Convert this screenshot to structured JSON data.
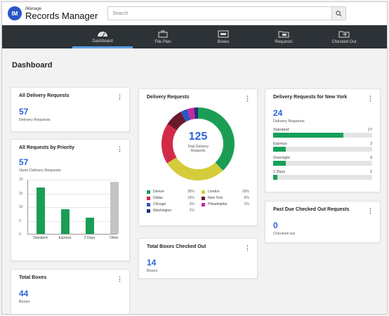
{
  "app": {
    "logo_text": "IM",
    "brand_small": "iManage",
    "brand_big": "Records Manager",
    "search_placeholder": "Search"
  },
  "nav": {
    "items": [
      {
        "label": "Dashboard",
        "icon": "gauge-icon",
        "active": true
      },
      {
        "label": "File Plan",
        "icon": "briefcase-icon",
        "active": false
      },
      {
        "label": "Boxes",
        "icon": "box-icon",
        "active": false
      },
      {
        "label": "Requests",
        "icon": "folder-request-icon",
        "active": false
      },
      {
        "label": "Checked Out",
        "icon": "folder-checkout-icon",
        "active": false
      }
    ]
  },
  "page": {
    "title": "Dashboard"
  },
  "cards": {
    "all_delivery": {
      "title": "All Delivery Requests",
      "value": "57",
      "sub": "Delivery Requests"
    },
    "by_priority": {
      "title": "All Requests by Priority",
      "value": "57",
      "sub": "Open Delivery Requests",
      "chart_data": {
        "type": "bar",
        "categories": [
          "Standard",
          "Express",
          "2 Days",
          "Other"
        ],
        "values": [
          17,
          9,
          6,
          19
        ],
        "colors": [
          "#1a9e55",
          "#1a9e55",
          "#1a9e55",
          "#c4c4c4"
        ],
        "yticks": [
          "20",
          "15",
          "10",
          "5",
          "0"
        ],
        "ylim": [
          0,
          20
        ]
      }
    },
    "total_boxes": {
      "title": "Total Boxes",
      "value": "44",
      "sub": "Boxes"
    },
    "delivery_requests": {
      "title": "Delivery Requests",
      "center_value": "125",
      "center_sub": "Total Delivery Requests",
      "chart_data": {
        "type": "pie",
        "series": [
          {
            "name": "Denver",
            "value": 38,
            "color": "#1a9e55",
            "pct": "38%"
          },
          {
            "name": "London",
            "value": 28,
            "color": "#d4cc3a",
            "pct": "28%"
          },
          {
            "name": "Dallas",
            "value": 18,
            "color": "#d42a4a",
            "pct": "18%"
          },
          {
            "name": "New York",
            "value": 8,
            "color": "#6b1a2a",
            "pct": "8%"
          },
          {
            "name": "Chicago",
            "value": 3,
            "color": "#2a56c6",
            "pct": "3%"
          },
          {
            "name": "Philadelphia",
            "value": 3,
            "color": "#c42a9e",
            "pct": "3%"
          },
          {
            "name": "Washington",
            "value": 2,
            "color": "#222e80",
            "pct": "2%"
          }
        ]
      }
    },
    "total_checked_out": {
      "title": "Total Boxes Checked Out",
      "value": "14",
      "sub": "Boxes"
    },
    "new_york": {
      "title": "Delivery Requests for New York",
      "value": "24",
      "sub": "Delivery Requests",
      "rows": [
        {
          "label": "Standard",
          "count": "17",
          "fraction": 0.71
        },
        {
          "label": "Express",
          "count": "3",
          "fraction": 0.13
        },
        {
          "label": "Overnight",
          "count": "3",
          "fraction": 0.13
        },
        {
          "label": "2 Days",
          "count": "1",
          "fraction": 0.04
        }
      ]
    },
    "past_due": {
      "title": "Past Due Checked Out Requests",
      "value": "0",
      "sub": "Checked out"
    }
  }
}
